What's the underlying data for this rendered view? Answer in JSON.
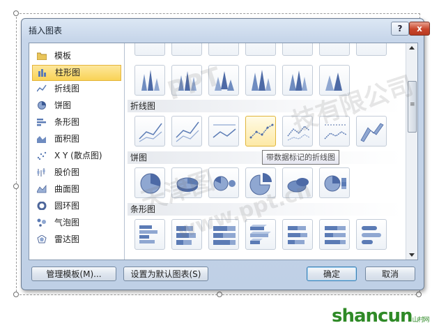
{
  "dialog": {
    "title": "插入图表",
    "help_label": "?",
    "close_label": "x"
  },
  "categories": [
    {
      "label": "模板",
      "icon": "folder-icon"
    },
    {
      "label": "柱形图",
      "icon": "column-chart-icon",
      "selected": true
    },
    {
      "label": "折线图",
      "icon": "line-chart-icon"
    },
    {
      "label": "饼图",
      "icon": "pie-chart-icon"
    },
    {
      "label": "条形图",
      "icon": "bar-chart-icon"
    },
    {
      "label": "面积图",
      "icon": "area-chart-icon"
    },
    {
      "label": "X Y (散点图)",
      "icon": "scatter-chart-icon"
    },
    {
      "label": "股价图",
      "icon": "stock-chart-icon"
    },
    {
      "label": "曲面图",
      "icon": "surface-chart-icon"
    },
    {
      "label": "圆环图",
      "icon": "doughnut-chart-icon"
    },
    {
      "label": "气泡图",
      "icon": "bubble-chart-icon"
    },
    {
      "label": "雷达图",
      "icon": "radar-chart-icon"
    }
  ],
  "sections": {
    "line": "折线图",
    "pie": "饼图",
    "bar": "条形图"
  },
  "tooltip": "带数据标记的折线图",
  "buttons": {
    "manage_templates": "管理模板(M)...",
    "set_default": "设置为默认图表(S)",
    "ok": "确定",
    "cancel": "取消"
  },
  "watermark": {
    "line1": "PPT",
    "line2": "天津图",
    "line3": "技有限公司",
    "line4": "www.ppt.cn"
  },
  "logo": {
    "text": "shancun",
    "suffix": "山村网"
  },
  "colors": {
    "accent": "#f9d356",
    "dialog": "#c7d6ea",
    "chart_blue": "#5b7bb5"
  }
}
